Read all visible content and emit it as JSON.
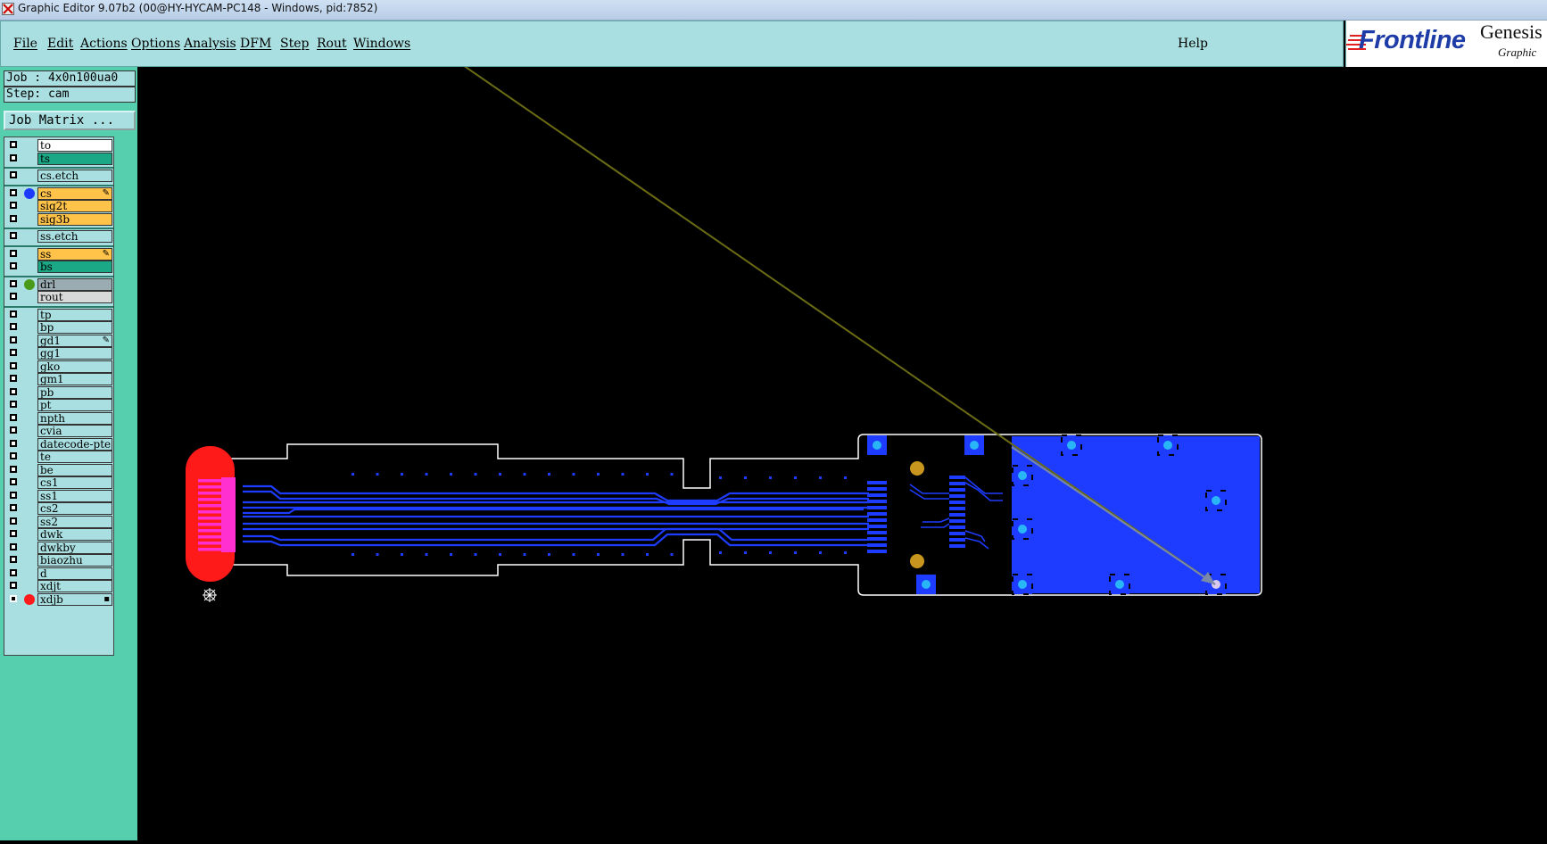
{
  "window": {
    "title": "Graphic Editor 9.07b2 (00@HY-HYCAM-PC148 - Windows, pid:7852)"
  },
  "menu": {
    "items": [
      "File",
      "Edit",
      "Actions",
      "Options",
      "Analysis",
      "DFM",
      "Step",
      "Rout",
      "Windows"
    ],
    "help": "Help"
  },
  "brand": {
    "logo_text": "Frontline",
    "product": "Genesis",
    "subtitle": "Graphic"
  },
  "job": {
    "job_line": "Job : 4x0n100ua0",
    "step_line": "Step: cam",
    "matrix_button": "Job Matrix ..."
  },
  "layers": [
    {
      "name": "to",
      "color": "#ffffff",
      "group": 0
    },
    {
      "name": "ts",
      "color": "#1aa886",
      "group": 0
    },
    {
      "name": "cs.etch",
      "color": "#a9dfe0",
      "group": 1
    },
    {
      "name": "cs",
      "color": "#ffc34a",
      "group": 2,
      "dot": "#1e3cff",
      "flag": "edit"
    },
    {
      "name": "sig2t",
      "color": "#ffc34a",
      "group": 2
    },
    {
      "name": "sig3b",
      "color": "#ffc34a",
      "group": 2
    },
    {
      "name": "ss.etch",
      "color": "#a9dfe0",
      "group": 3
    },
    {
      "name": "ss",
      "color": "#ffc34a",
      "group": 4,
      "flag": "edit"
    },
    {
      "name": "bs",
      "color": "#1aa886",
      "group": 4
    },
    {
      "name": "drl",
      "color": "#9aabb2",
      "group": 5,
      "dot": "#4a9a1a"
    },
    {
      "name": "rout",
      "color": "#d8dada",
      "group": 5
    },
    {
      "name": "tp",
      "color": "#a9dfe0",
      "group": 6
    },
    {
      "name": "bp",
      "color": "#a9dfe0",
      "group": 6
    },
    {
      "name": "gd1",
      "color": "#a9dfe0",
      "group": 6,
      "flag": "edit"
    },
    {
      "name": "gg1",
      "color": "#a9dfe0",
      "group": 6
    },
    {
      "name": "gko",
      "color": "#a9dfe0",
      "group": 6
    },
    {
      "name": "gm1",
      "color": "#a9dfe0",
      "group": 6
    },
    {
      "name": "pb",
      "color": "#a9dfe0",
      "group": 6
    },
    {
      "name": "pt",
      "color": "#a9dfe0",
      "group": 6
    },
    {
      "name": "npth",
      "color": "#a9dfe0",
      "group": 6
    },
    {
      "name": "cvia",
      "color": "#a9dfe0",
      "group": 6
    },
    {
      "name": "datecode-pte",
      "color": "#a9dfe0",
      "group": 6
    },
    {
      "name": "te",
      "color": "#a9dfe0",
      "group": 6
    },
    {
      "name": "be",
      "color": "#a9dfe0",
      "group": 6
    },
    {
      "name": "cs1",
      "color": "#a9dfe0",
      "group": 6
    },
    {
      "name": "ss1",
      "color": "#a9dfe0",
      "group": 6
    },
    {
      "name": "cs2",
      "color": "#a9dfe0",
      "group": 6
    },
    {
      "name": "ss2",
      "color": "#a9dfe0",
      "group": 6
    },
    {
      "name": "dwk",
      "color": "#a9dfe0",
      "group": 6
    },
    {
      "name": "dwkby",
      "color": "#a9dfe0",
      "group": 6
    },
    {
      "name": "biaozhu",
      "color": "#a9dfe0",
      "group": 6
    },
    {
      "name": "d",
      "color": "#a9dfe0",
      "group": 6
    },
    {
      "name": "xdjt",
      "color": "#a9dfe0",
      "group": 6
    },
    {
      "name": "xdjb",
      "color": "#a9dfe0",
      "group": 6,
      "dot": "#ff1a1a",
      "flag": "box",
      "checked": true
    }
  ],
  "colors": {
    "canvas_bg": "#000000",
    "copper": "#1e3cff",
    "pad": "#29b6f6",
    "outline": "#ffffff",
    "connector": "#ff1a1a",
    "fingers": "#ff2fd0",
    "drill": "#c8961e",
    "measure_line": "#6b6b14"
  }
}
